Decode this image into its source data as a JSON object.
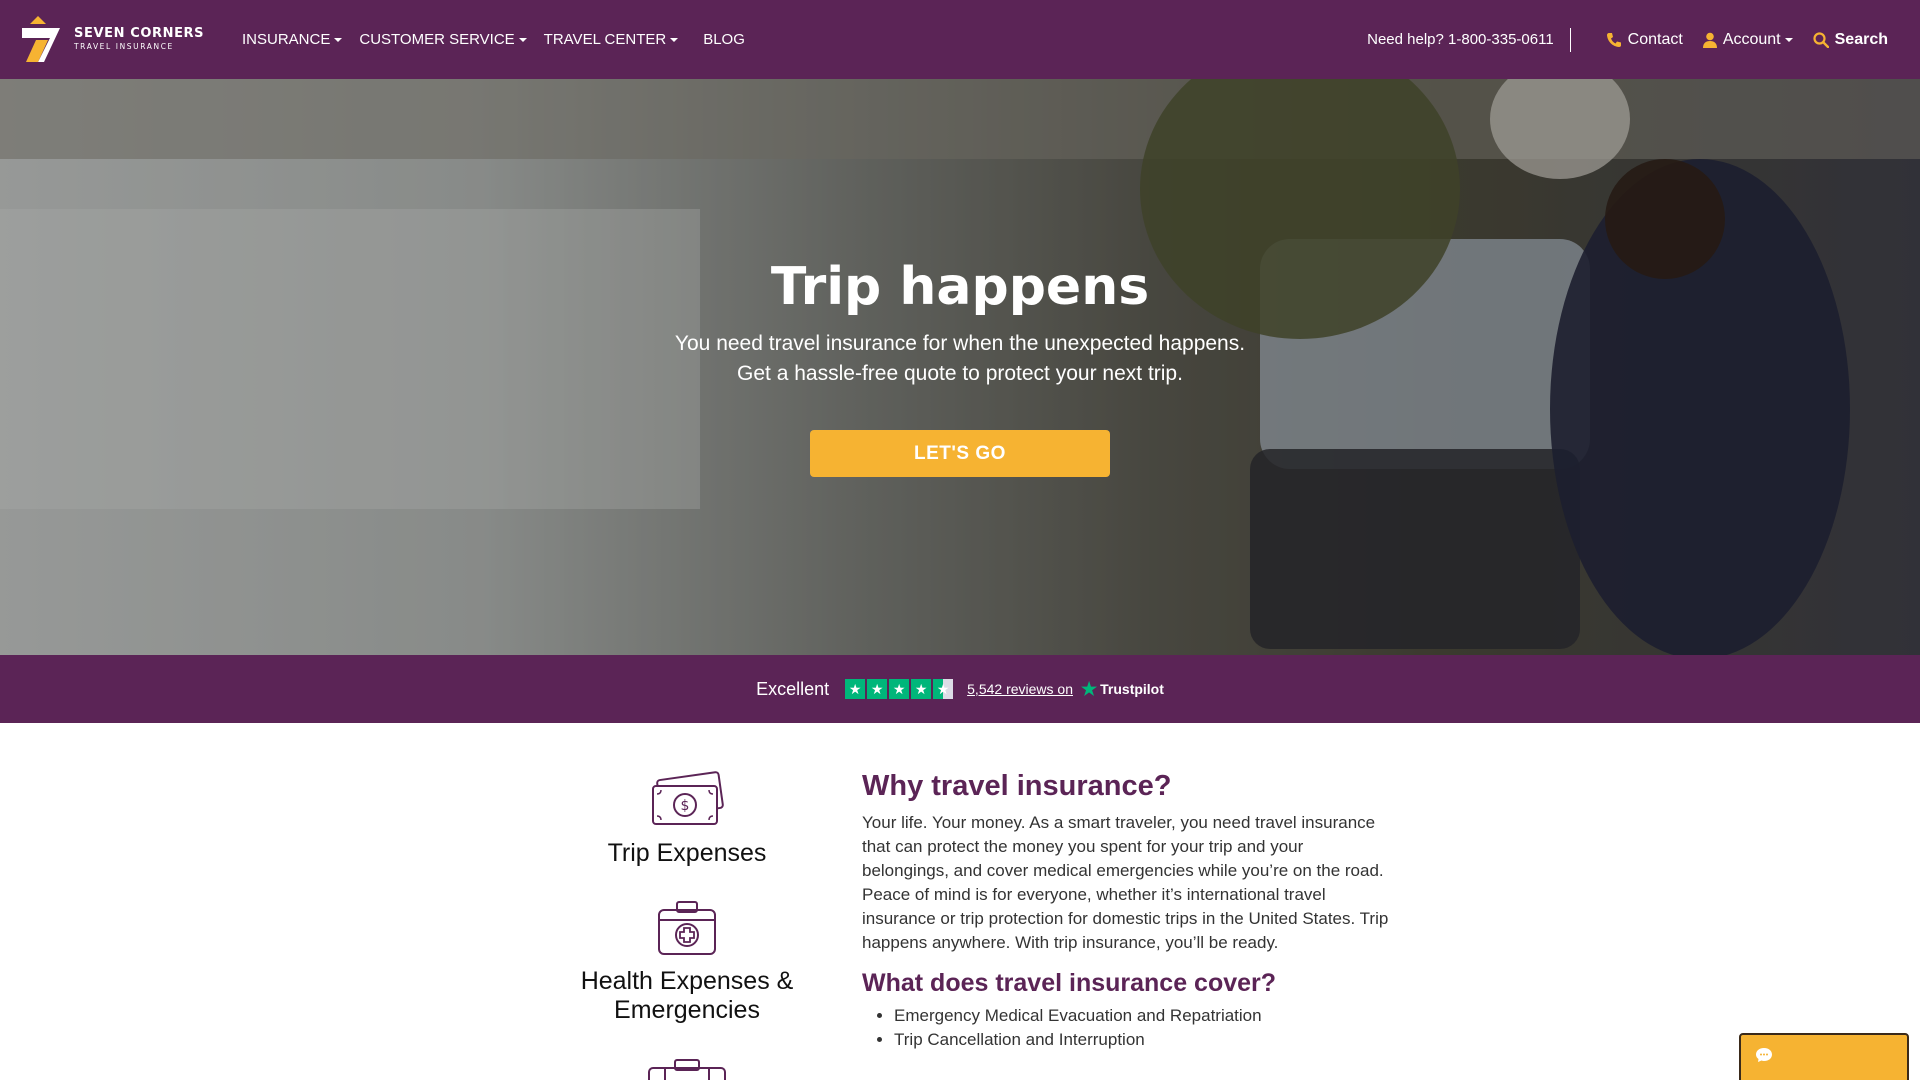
{
  "brand": {
    "name_line1": "SEVEN CORNERS",
    "name_line2": "TRAVEL INSURANCE",
    "colors": {
      "primary": "#5b2456",
      "accent": "#f6b332",
      "trustpilot": "#00b67a"
    }
  },
  "nav": {
    "items": [
      {
        "label": "INSURANCE",
        "dropdown": true
      },
      {
        "label": "CUSTOMER SERVICE",
        "dropdown": true
      },
      {
        "label": "TRAVEL CENTER",
        "dropdown": true
      },
      {
        "label": "BLOG",
        "dropdown": false
      }
    ],
    "help": "Need help? 1-800-335-0611",
    "contact": "Contact",
    "account": "Account",
    "search": "Search"
  },
  "hero": {
    "title": "Trip happens",
    "subtitle": "You need travel insurance for when the unexpected happens. Get a hassle-free quote to protect your next trip.",
    "cta": "LET'S GO"
  },
  "trustpilot": {
    "rating_label": "Excellent",
    "stars": 4.5,
    "reviews": "5,542 reviews on",
    "brand": "Trustpilot"
  },
  "features": [
    {
      "label": "Trip Expenses",
      "icon": "money-icon"
    },
    {
      "label": "Health Expenses & Emergencies",
      "icon": "medical-kit-icon"
    },
    {
      "label": "",
      "icon": "suitcase-icon"
    }
  ],
  "content": {
    "heading": "Why travel insurance?",
    "paragraph": "Your life. Your money. As a smart traveler, you need travel insurance that can protect the money you spent for your trip and your belongings, and cover medical emergencies while you’re on the road. Peace of mind is for everyone, whether it’s international travel insurance or trip protection for domestic trips in the United States. Trip happens anywhere. With trip insurance, you’ll be ready.",
    "subheading": "What does travel insurance cover?",
    "list": [
      "Emergency Medical Evacuation and Repatriation",
      "Trip Cancellation and Interruption"
    ]
  },
  "chat": {
    "icon": "chat-icon"
  }
}
